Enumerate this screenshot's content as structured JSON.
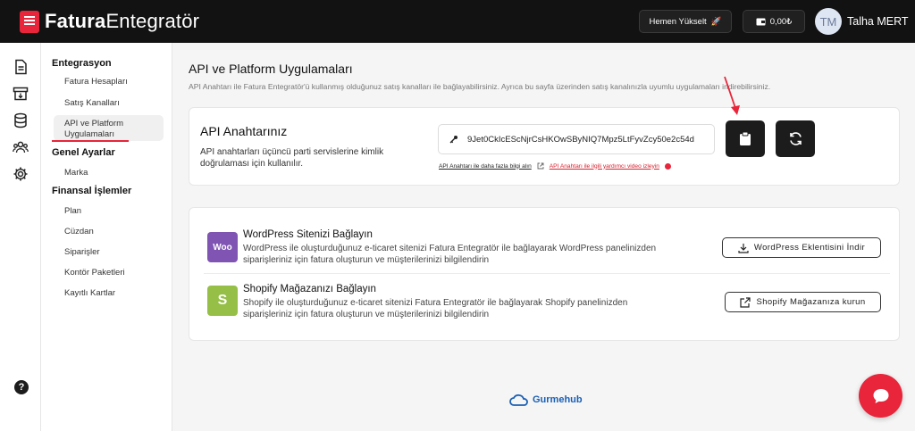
{
  "header": {
    "brand_bold": "Fatura",
    "brand_light": "Entegratör",
    "upgrade_label": "Hemen Yükselt",
    "balance": "0,00₺",
    "avatar_initials": "TM",
    "username": "Talha MERT"
  },
  "rail": {
    "icons": [
      "document-icon",
      "archive-icon",
      "database-icon",
      "users-icon",
      "gear-icon"
    ],
    "help_label": "?"
  },
  "submenu": {
    "sections": [
      {
        "title": "Entegrasyon",
        "items": [
          "Fatura Hesapları",
          "Satış Kanalları",
          "API ve Platform",
          "Uygulamaları"
        ]
      },
      {
        "title": "Genel Ayarlar",
        "items": [
          "Marka"
        ]
      },
      {
        "title": "Finansal İşlemler",
        "items": [
          "Plan",
          "Cüzdan",
          "Siparişler",
          "Kontör Paketleri",
          "Kayıtlı Kartlar"
        ]
      }
    ]
  },
  "page": {
    "title": "API ve Platform Uygulamaları",
    "description": "API Anahtarı ile Fatura Entegratör'ü kullanmış olduğunuz satış kanalları ile bağlayabilirsiniz. Ayrıca bu sayfa üzerinden satış kanalınızla uyumlu uygulamaları indirebilirsiniz."
  },
  "api": {
    "title": "API Anahtarınız",
    "description": "API anahtarları üçüncü parti servislerine kimlik doğrulaması için kullanılır.",
    "key_value": "9Jet0CkIcEScNjrCsHKOwSByNIQ7Mpz5LtFyvZcy50e2c54d",
    "info_link": "API Anahtarı ile daha fazla bilgi alın",
    "video_link": "API Anahtarı ile ilgili yardımcı video izleyin"
  },
  "platforms": [
    {
      "logo_text": "Woo",
      "logo_color": "#7f54b3",
      "title": "WordPress Sitenizi Bağlayın",
      "description": "WordPress ile oluşturduğunuz e-ticaret sitenizi Fatura Entegratör ile bağlayarak WordPress panelinizden siparişleriniz için fatura oluşturun ve müşterilerinizi bilgilendirin",
      "button_label": "WordPress Eklentisini İndir"
    },
    {
      "logo_text": "S",
      "logo_color": "#95bf47",
      "title": "Shopify Mağazanızı Bağlayın",
      "description": "Shopify ile oluşturduğunuz e-ticaret sitenizi Fatura Entegratör ile bağlayarak Shopify panelinizden siparişleriniz için fatura oluşturun ve müşterilerinizi bilgilendirin",
      "button_label": "Shopify Mağazanıza kurun"
    }
  ],
  "footer": {
    "brand": "Gurmehub"
  },
  "colors": {
    "accent": "#e8253a",
    "header_bg": "#121212",
    "footer_brand": "#1a5fb4"
  }
}
